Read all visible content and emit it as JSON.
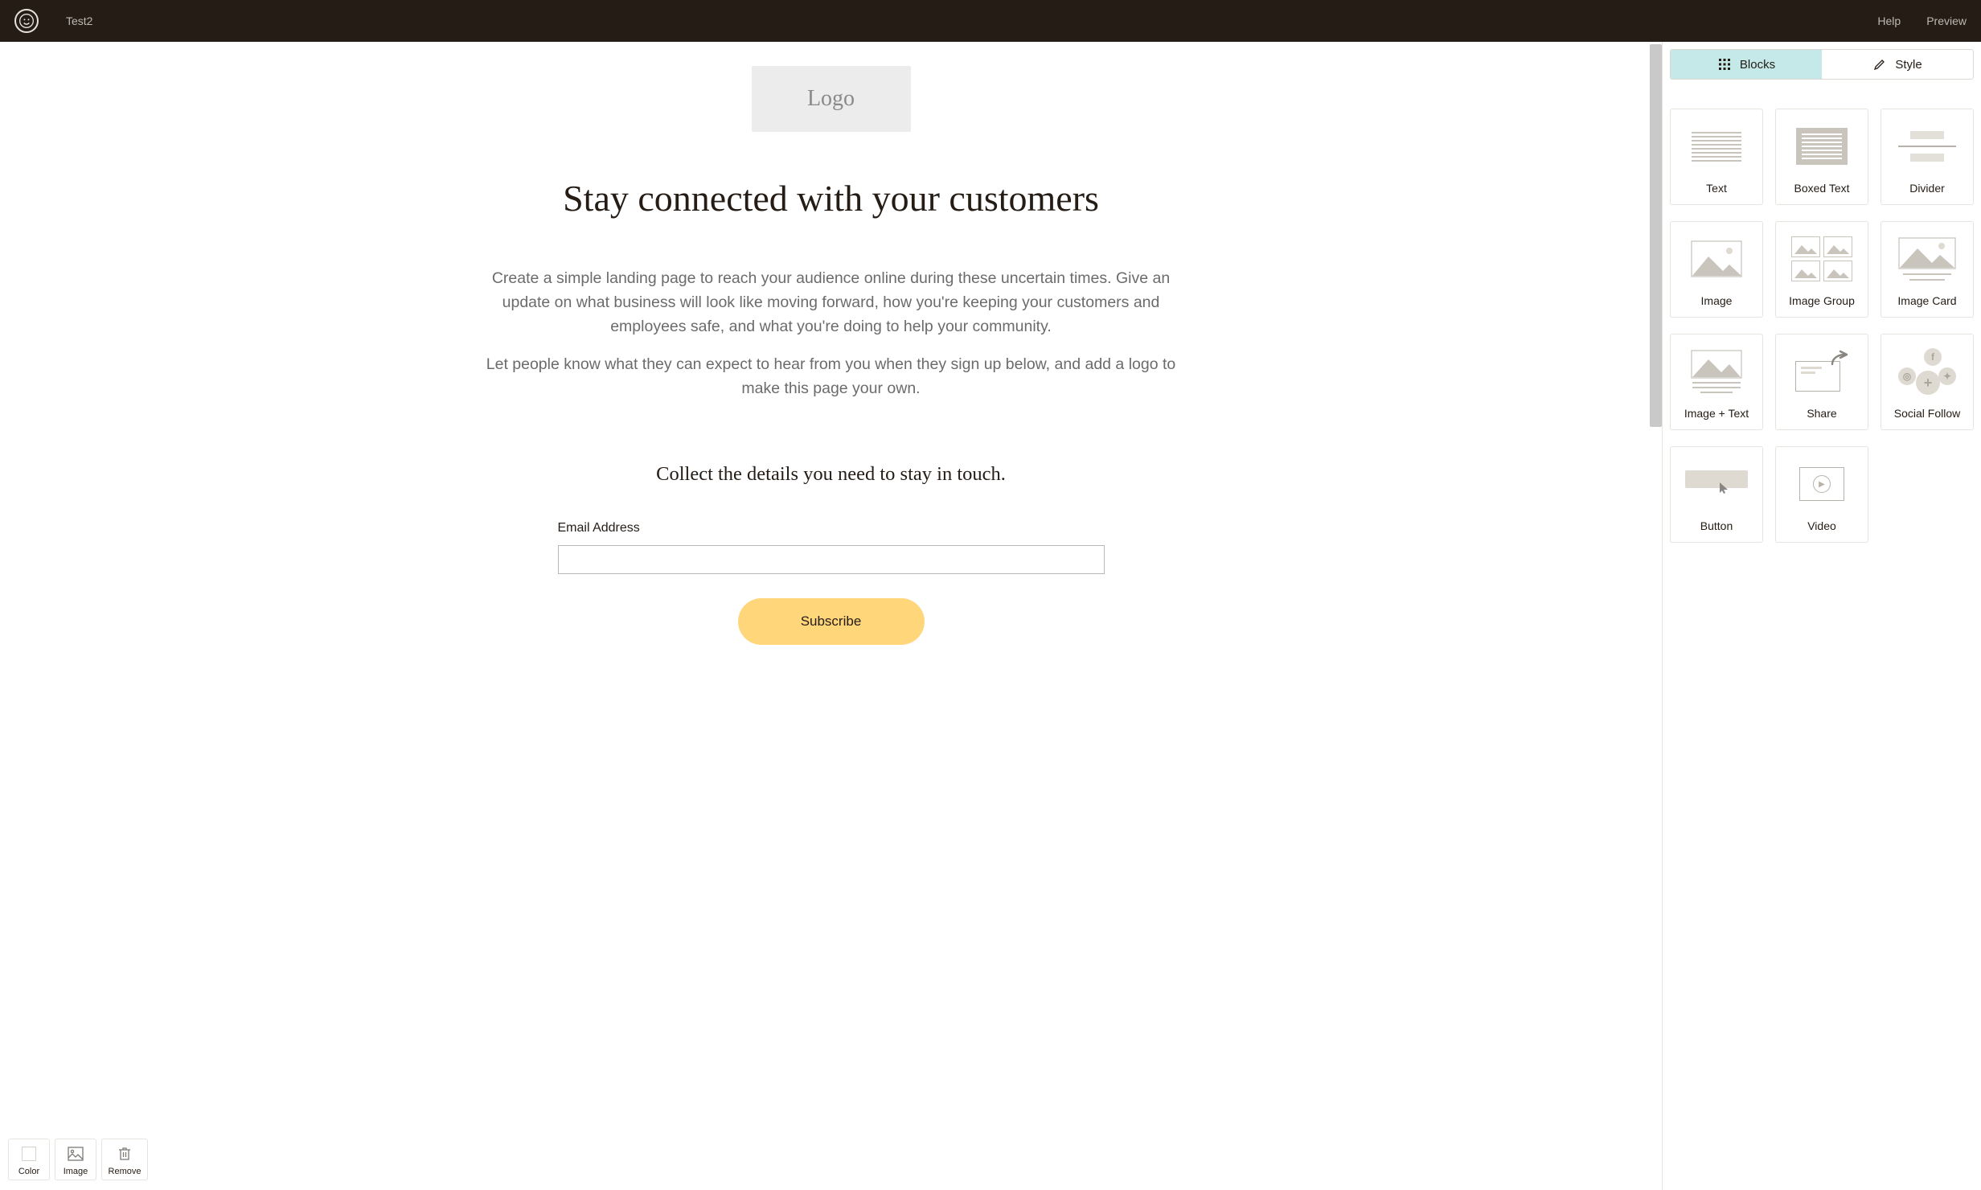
{
  "topbar": {
    "page_name": "Test2",
    "help": "Help",
    "preview": "Preview"
  },
  "canvas": {
    "logo_placeholder": "Logo",
    "headline": "Stay connected with your customers",
    "paragraph1": "Create a simple landing page to reach your audience online during these uncertain times. Give an update on what business will look like moving forward, how you're keeping your customers and employees safe, and what you're doing to help your community.",
    "paragraph2": "Let people know what they can expect to hear from you when they sign up below, and add a logo to make this page your own.",
    "sub_headline": "Collect the details you need to stay in touch.",
    "email_label": "Email Address",
    "subscribe_label": "Subscribe"
  },
  "floating_toolbar": {
    "color": "Color",
    "image": "Image",
    "remove": "Remove"
  },
  "sidebar": {
    "tabs": {
      "blocks": "Blocks",
      "style": "Style"
    },
    "blocks": [
      {
        "label": "Text"
      },
      {
        "label": "Boxed Text"
      },
      {
        "label": "Divider"
      },
      {
        "label": "Image"
      },
      {
        "label": "Image Group"
      },
      {
        "label": "Image Card"
      },
      {
        "label": "Image + Text"
      },
      {
        "label": "Share"
      },
      {
        "label": "Social Follow"
      },
      {
        "label": "Button"
      },
      {
        "label": "Video"
      }
    ]
  }
}
